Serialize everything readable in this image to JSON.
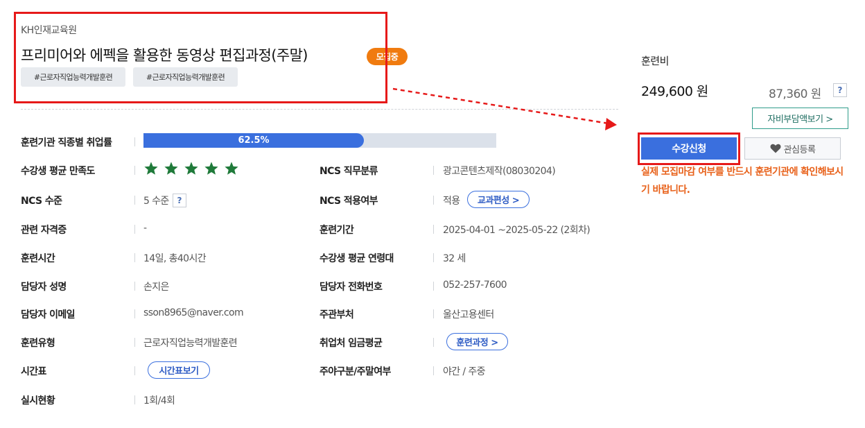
{
  "header": {
    "institution": "KH인재교육원",
    "title": "프리미어와 에펙을 활용한 동영상 편집과정(주말)",
    "status_badge": "모집중",
    "tags": [
      "#근로자직업능력개발훈련",
      "#근로자직업능력개발훈련"
    ]
  },
  "employment_rate": {
    "label": "훈련기관 직종별 취업률",
    "value_text": "62.5%",
    "fraction": 0.625
  },
  "info": {
    "satisfaction": {
      "label": "수강생 평균 만족도",
      "stars_filled": 5,
      "stars_total": 5
    },
    "ncs_category": {
      "label": "NCS 직무분류",
      "value": "광고콘텐츠제작(08030204)"
    },
    "ncs_level": {
      "label": "NCS 수준",
      "value": "5 수준",
      "help": "?"
    },
    "ncs_applied": {
      "label": "NCS 적용여부",
      "value": "적용",
      "button": "교과편성 >"
    },
    "certificate": {
      "label": "관련 자격증",
      "value": "-"
    },
    "period": {
      "label": "훈련기간",
      "value": "2025-04-01 ~2025-05-22 (2회차)"
    },
    "hours": {
      "label": "훈련시간",
      "value": "14일, 총40시간"
    },
    "avg_age": {
      "label": "수강생 평균 연령대",
      "value": "32 세"
    },
    "manager_name": {
      "label": "담당자 성명",
      "value": "손지은"
    },
    "manager_phone": {
      "label": "담당자 전화번호",
      "value": "052-257-7600"
    },
    "manager_email": {
      "label": "담당자 이메일",
      "value": "sson8965@naver.com"
    },
    "supervising": {
      "label": "주관부처",
      "value": "울산고용센터"
    },
    "training_type": {
      "label": "훈련유형",
      "value": "근로자직업능력개발훈련"
    },
    "wage": {
      "label": "취업처 임금평균",
      "button": "훈련과정 >"
    },
    "timetable": {
      "label": "시간표",
      "button": "시간표보기"
    },
    "day_night": {
      "label": "주야구분/주말여부",
      "value": "야간 / 주중"
    },
    "status": {
      "label": "실시현황",
      "value": "1회/4회"
    }
  },
  "fee": {
    "label": "훈련비",
    "price": "249,600 원",
    "self_pay": "87,360 원",
    "help": "?",
    "self_pay_button": "자비부담액보기 >"
  },
  "actions": {
    "apply": "수강신청",
    "wishlist": "관심등록",
    "notice": "실제 모집마감 여부를 반드시 훈련기관에 확인해보시기 바랍니다."
  },
  "colors": {
    "accent": "#3a6fde",
    "badge": "#f07b0f",
    "notice": "#e8611a",
    "star": "#1f7a3a",
    "highlight": "#e61919"
  }
}
